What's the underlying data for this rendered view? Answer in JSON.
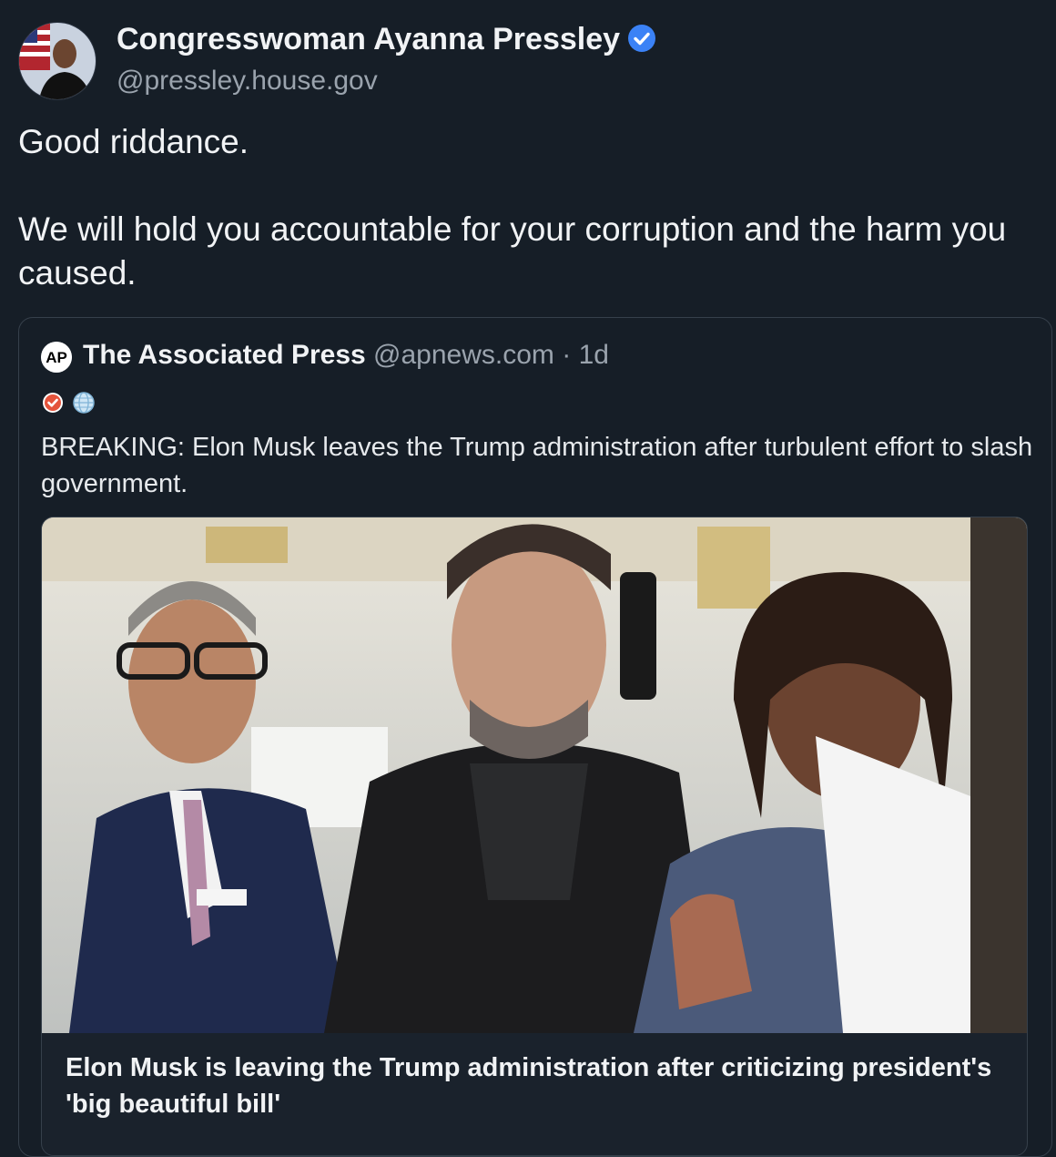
{
  "post": {
    "author_name": "Congresswoman Ayanna Pressley",
    "author_handle": "@pressley.house.gov",
    "text_line1": "Good riddance.",
    "text_line2": "We will hold you accountable for your corruption and the harm you caused."
  },
  "quote": {
    "source_name": "The Associated Press",
    "source_meta": "@apnews.com · 1d",
    "avatar_text": "AP",
    "badges": [
      "verified-check-badge",
      "globe-icon"
    ],
    "text": "BREAKING: Elon Musk leaves the Trump administration after turbulent effort to slash government.",
    "card_title": "Elon Musk is leaving the Trump administration after criticizing president's 'big beautiful bill'"
  },
  "colors": {
    "background": "#161e27",
    "verified_blue": "#3b82f6",
    "muted_text": "#9aa3ad",
    "border": "#36404b"
  }
}
